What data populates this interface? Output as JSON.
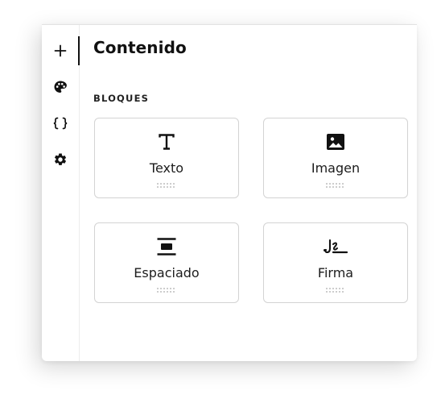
{
  "sidebar": {
    "items": [
      {
        "icon": "plus-icon",
        "active": true
      },
      {
        "icon": "palette-icon",
        "active": false
      },
      {
        "icon": "braces-icon",
        "active": false
      },
      {
        "icon": "gear-icon",
        "active": false
      }
    ]
  },
  "panel": {
    "title": "Contenido",
    "section_label": "BLOQUES",
    "blocks": [
      {
        "label": "Texto",
        "icon": "text-icon"
      },
      {
        "label": "Imagen",
        "icon": "image-icon"
      },
      {
        "label": "Espaciado",
        "icon": "spacer-icon"
      },
      {
        "label": "Firma",
        "icon": "signature-icon"
      }
    ]
  },
  "colors": {
    "text": "#111111",
    "border": "#d3d3d3",
    "handle": "#bdbdbd"
  }
}
